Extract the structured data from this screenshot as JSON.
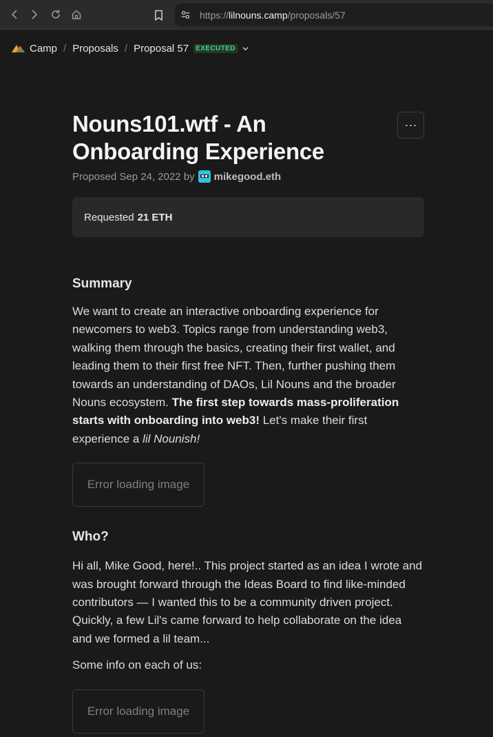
{
  "browser": {
    "url_prefix": "https://",
    "url_host": "lilnouns.camp",
    "url_path": "/proposals/57"
  },
  "breadcrumb": {
    "items": [
      "Camp",
      "Proposals",
      "Proposal 57"
    ],
    "separator": "/",
    "status_badge": "EXECUTED"
  },
  "proposal": {
    "title": "Nouns101.wtf - An Onboarding Experience",
    "proposed_prefix": "Proposed Sep 24, 2022 by",
    "author": "mikegood.eth",
    "requested_label": "Requested",
    "requested_amount": "21 ETH",
    "more_label": "···"
  },
  "summary": {
    "heading": "Summary",
    "text_1": "We want to create an interactive onboarding experience for newcomers to web3. Topics range from understanding web3, walking them through the basics, creating their first wallet, and leading them to their first free NFT. Then, further pushing them towards an understanding of DAOs, Lil Nouns and the broader Nouns ecosystem. ",
    "bold": "The first step towards mass-proliferation starts with onboarding into web3!",
    "text_2": " Let's make their first experience a ",
    "italic": "lil Nounish!",
    "image_error": "Error loading image"
  },
  "who": {
    "heading": "Who?",
    "text": "Hi all, Mike Good, here!.. This project started as an idea I wrote and was brought forward through the Ideas Board to find like-minded contributors — I wanted this to be a community driven project. Quickly, a few Lil's came forward to help collaborate on the idea and we formed a lil team...",
    "text_2": "Some info on each of us:",
    "image_error": "Error loading image"
  },
  "colors": {
    "background": "#1a1a1a",
    "badge_green": "#57c98a",
    "avatar_cyan": "#2ec3d6"
  }
}
